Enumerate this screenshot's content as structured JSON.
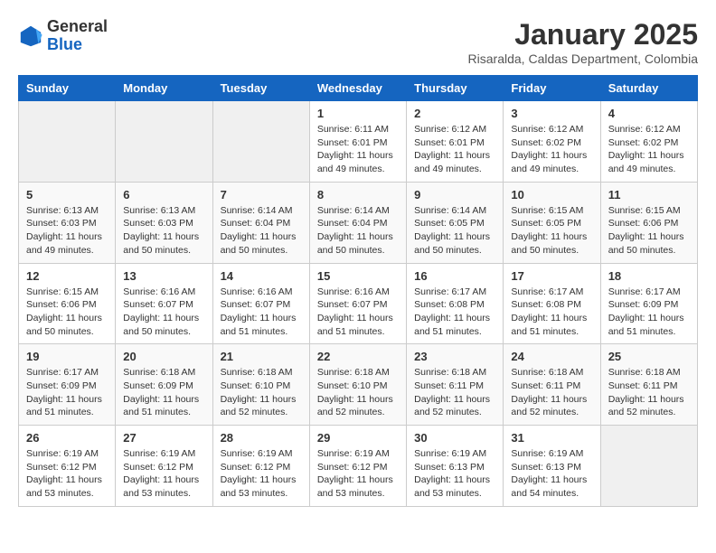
{
  "header": {
    "logo_general": "General",
    "logo_blue": "Blue",
    "month_title": "January 2025",
    "location": "Risaralda, Caldas Department, Colombia"
  },
  "weekdays": [
    "Sunday",
    "Monday",
    "Tuesday",
    "Wednesday",
    "Thursday",
    "Friday",
    "Saturday"
  ],
  "weeks": [
    [
      {
        "day": "",
        "info": ""
      },
      {
        "day": "",
        "info": ""
      },
      {
        "day": "",
        "info": ""
      },
      {
        "day": "1",
        "info": "Sunrise: 6:11 AM\nSunset: 6:01 PM\nDaylight: 11 hours\nand 49 minutes."
      },
      {
        "day": "2",
        "info": "Sunrise: 6:12 AM\nSunset: 6:01 PM\nDaylight: 11 hours\nand 49 minutes."
      },
      {
        "day": "3",
        "info": "Sunrise: 6:12 AM\nSunset: 6:02 PM\nDaylight: 11 hours\nand 49 minutes."
      },
      {
        "day": "4",
        "info": "Sunrise: 6:12 AM\nSunset: 6:02 PM\nDaylight: 11 hours\nand 49 minutes."
      }
    ],
    [
      {
        "day": "5",
        "info": "Sunrise: 6:13 AM\nSunset: 6:03 PM\nDaylight: 11 hours\nand 49 minutes."
      },
      {
        "day": "6",
        "info": "Sunrise: 6:13 AM\nSunset: 6:03 PM\nDaylight: 11 hours\nand 50 minutes."
      },
      {
        "day": "7",
        "info": "Sunrise: 6:14 AM\nSunset: 6:04 PM\nDaylight: 11 hours\nand 50 minutes."
      },
      {
        "day": "8",
        "info": "Sunrise: 6:14 AM\nSunset: 6:04 PM\nDaylight: 11 hours\nand 50 minutes."
      },
      {
        "day": "9",
        "info": "Sunrise: 6:14 AM\nSunset: 6:05 PM\nDaylight: 11 hours\nand 50 minutes."
      },
      {
        "day": "10",
        "info": "Sunrise: 6:15 AM\nSunset: 6:05 PM\nDaylight: 11 hours\nand 50 minutes."
      },
      {
        "day": "11",
        "info": "Sunrise: 6:15 AM\nSunset: 6:06 PM\nDaylight: 11 hours\nand 50 minutes."
      }
    ],
    [
      {
        "day": "12",
        "info": "Sunrise: 6:15 AM\nSunset: 6:06 PM\nDaylight: 11 hours\nand 50 minutes."
      },
      {
        "day": "13",
        "info": "Sunrise: 6:16 AM\nSunset: 6:07 PM\nDaylight: 11 hours\nand 50 minutes."
      },
      {
        "day": "14",
        "info": "Sunrise: 6:16 AM\nSunset: 6:07 PM\nDaylight: 11 hours\nand 51 minutes."
      },
      {
        "day": "15",
        "info": "Sunrise: 6:16 AM\nSunset: 6:07 PM\nDaylight: 11 hours\nand 51 minutes."
      },
      {
        "day": "16",
        "info": "Sunrise: 6:17 AM\nSunset: 6:08 PM\nDaylight: 11 hours\nand 51 minutes."
      },
      {
        "day": "17",
        "info": "Sunrise: 6:17 AM\nSunset: 6:08 PM\nDaylight: 11 hours\nand 51 minutes."
      },
      {
        "day": "18",
        "info": "Sunrise: 6:17 AM\nSunset: 6:09 PM\nDaylight: 11 hours\nand 51 minutes."
      }
    ],
    [
      {
        "day": "19",
        "info": "Sunrise: 6:17 AM\nSunset: 6:09 PM\nDaylight: 11 hours\nand 51 minutes."
      },
      {
        "day": "20",
        "info": "Sunrise: 6:18 AM\nSunset: 6:09 PM\nDaylight: 11 hours\nand 51 minutes."
      },
      {
        "day": "21",
        "info": "Sunrise: 6:18 AM\nSunset: 6:10 PM\nDaylight: 11 hours\nand 52 minutes."
      },
      {
        "day": "22",
        "info": "Sunrise: 6:18 AM\nSunset: 6:10 PM\nDaylight: 11 hours\nand 52 minutes."
      },
      {
        "day": "23",
        "info": "Sunrise: 6:18 AM\nSunset: 6:11 PM\nDaylight: 11 hours\nand 52 minutes."
      },
      {
        "day": "24",
        "info": "Sunrise: 6:18 AM\nSunset: 6:11 PM\nDaylight: 11 hours\nand 52 minutes."
      },
      {
        "day": "25",
        "info": "Sunrise: 6:18 AM\nSunset: 6:11 PM\nDaylight: 11 hours\nand 52 minutes."
      }
    ],
    [
      {
        "day": "26",
        "info": "Sunrise: 6:19 AM\nSunset: 6:12 PM\nDaylight: 11 hours\nand 53 minutes."
      },
      {
        "day": "27",
        "info": "Sunrise: 6:19 AM\nSunset: 6:12 PM\nDaylight: 11 hours\nand 53 minutes."
      },
      {
        "day": "28",
        "info": "Sunrise: 6:19 AM\nSunset: 6:12 PM\nDaylight: 11 hours\nand 53 minutes."
      },
      {
        "day": "29",
        "info": "Sunrise: 6:19 AM\nSunset: 6:12 PM\nDaylight: 11 hours\nand 53 minutes."
      },
      {
        "day": "30",
        "info": "Sunrise: 6:19 AM\nSunset: 6:13 PM\nDaylight: 11 hours\nand 53 minutes."
      },
      {
        "day": "31",
        "info": "Sunrise: 6:19 AM\nSunset: 6:13 PM\nDaylight: 11 hours\nand 54 minutes."
      },
      {
        "day": "",
        "info": ""
      }
    ]
  ]
}
